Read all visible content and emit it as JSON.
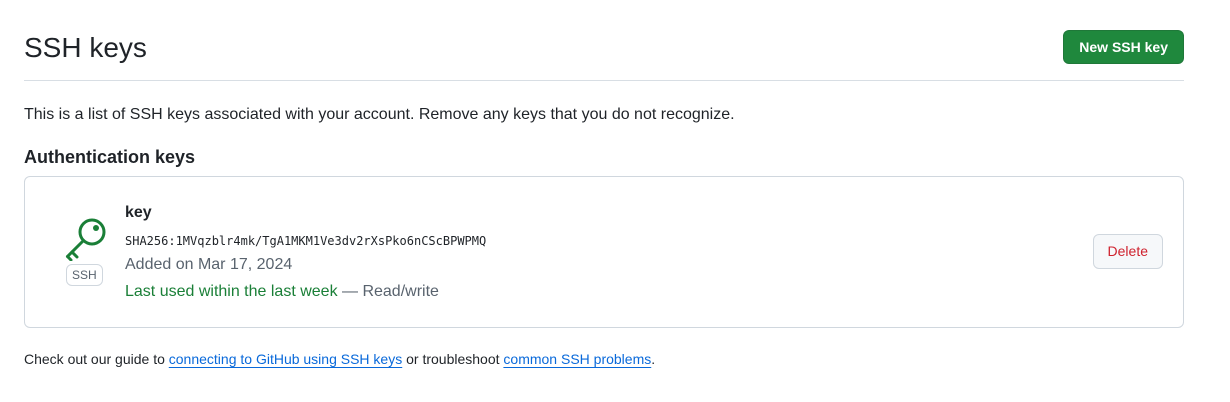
{
  "header": {
    "title": "SSH keys",
    "new_key_button": "New SSH key"
  },
  "intro": "This is a list of SSH keys associated with your account. Remove any keys that you do not recognize.",
  "section": {
    "title": "Authentication keys"
  },
  "key": {
    "icon": "key-icon",
    "type_label": "SSH",
    "name": "key",
    "fingerprint": "SHA256:1MVqzblr4mk/TgA1MKM1Ve3dv2rXsPko6nCScBPWPMQ",
    "added": "Added on Mar 17, 2024",
    "last_used": "Last used within the last week",
    "separator": " — ",
    "access": "Read/write",
    "delete_button": "Delete"
  },
  "footer": {
    "prefix": "Check out our guide to ",
    "link1": "connecting to GitHub using SSH keys",
    "middle": " or troubleshoot ",
    "link2": "common SSH problems",
    "suffix": "."
  },
  "colors": {
    "primary_button": "#1f883d",
    "success_text": "#1a7f37",
    "danger_text": "#cf222e",
    "link": "#0969da",
    "border": "#d0d7de"
  }
}
